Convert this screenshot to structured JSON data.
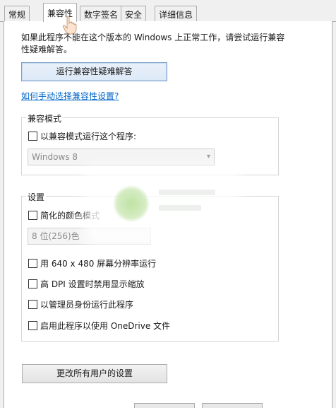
{
  "tabs": [
    "常规",
    "兼容性",
    "数字签名",
    "安全",
    "详细信息"
  ],
  "info_text": "如果此程序不能在这个版本的 Windows 上正常工作，请尝试运行兼容性疑难解答。",
  "run_troubleshooter_button": "运行兼容性疑难解答",
  "manual_link": "如何手动选择兼容性设置?",
  "compat_mode": {
    "title": "兼容模式",
    "checkbox_label": "以兼容模式运行这个程序:",
    "checked": false,
    "select_value": "Windows 8"
  },
  "settings": {
    "title": "设置",
    "reduced_color_label": "简化的颜色模式",
    "reduced_color_checked": false,
    "color_select_value": "8 位(256)色",
    "res_640_label": "用 640 x 480 屏幕分辨率运行",
    "dpi_label": "高 DPI 设置时禁用显示缩放",
    "admin_label": "以管理员身份运行此程序",
    "onedrive_label": "启用此程序以使用 OneDrive 文件"
  },
  "change_all_users_button": "更改所有用户的设置"
}
